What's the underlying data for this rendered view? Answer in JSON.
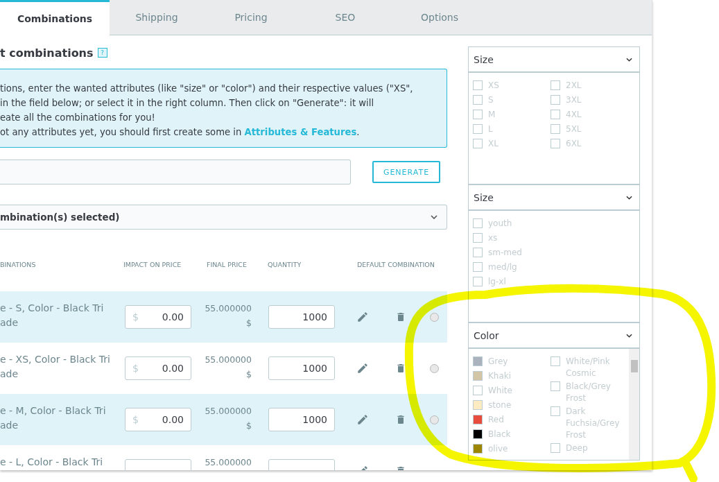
{
  "tabs": [
    {
      "label": "Combinations",
      "selected": true
    },
    {
      "label": "Shipping",
      "selected": false
    },
    {
      "label": "Pricing",
      "selected": false
    },
    {
      "label": "SEO",
      "selected": false
    },
    {
      "label": "Options",
      "selected": false
    }
  ],
  "heading": {
    "title": "t combinations",
    "help": "?"
  },
  "info": {
    "lines": [
      "tions, enter the wanted attributes (like \"size\" or \"color\") and their respective values (\"XS\",",
      "in the field below; or select it in the right column. Then click on \"Generate\": it will",
      "eate all the combinations for you!",
      "ot any attributes yet, you should first create some in "
    ],
    "link": "Attributes & Features",
    "after": "."
  },
  "generate_button": "GENERATE",
  "bulk_select": {
    "label": "mbination(s) selected)"
  },
  "table": {
    "columns": [
      "BINATIONS",
      "IMPACT ON PRICE",
      "FINAL PRICE",
      "QUANTITY",
      "DEFAULT COMBINATION"
    ],
    "rows": [
      {
        "combination": [
          "e - S, Color - Black Tri",
          "ade"
        ],
        "currency": "$",
        "impact": "0.00",
        "final_price": "55.000000",
        "final_currency": "$",
        "quantity": "1000",
        "selected": false
      },
      {
        "combination": [
          "e - XS, Color - Black Tri",
          "ade"
        ],
        "currency": "$",
        "impact": "0.00",
        "final_price": "55.000000",
        "final_currency": "$",
        "quantity": "1000",
        "selected": false
      },
      {
        "combination": [
          "e - M, Color - Black Tri",
          "ade"
        ],
        "currency": "$",
        "impact": "0.00",
        "final_price": "55.000000",
        "final_currency": "$",
        "quantity": "1000",
        "selected": false
      },
      {
        "combination": [
          "e - L, Color - Black Tri"
        ],
        "final_price": "55.000000"
      }
    ]
  },
  "attribute_groups": [
    {
      "title": "Size",
      "columns": [
        [
          {
            "kind": "checkbox",
            "label": "XS",
            "checked": false
          },
          {
            "kind": "checkbox",
            "label": "S",
            "checked": false
          },
          {
            "kind": "checkbox",
            "label": "M",
            "checked": false
          },
          {
            "kind": "checkbox",
            "label": "L",
            "checked": false
          },
          {
            "kind": "checkbox",
            "label": "XL",
            "checked": false
          }
        ],
        [
          {
            "kind": "checkbox",
            "label": "2XL",
            "checked": false
          },
          {
            "kind": "checkbox",
            "label": "3XL",
            "checked": false
          },
          {
            "kind": "checkbox",
            "label": "4XL",
            "checked": false
          },
          {
            "kind": "checkbox",
            "label": "5XL",
            "checked": false
          },
          {
            "kind": "checkbox",
            "label": "6XL",
            "checked": false
          }
        ]
      ]
    },
    {
      "title": "Size",
      "columns": [
        [
          {
            "kind": "checkbox",
            "label": "youth",
            "checked": false
          },
          {
            "kind": "checkbox",
            "label": "xs",
            "checked": false
          },
          {
            "kind": "checkbox",
            "label": "sm-med",
            "checked": false
          },
          {
            "kind": "checkbox",
            "label": "med/lg",
            "checked": false
          },
          {
            "kind": "checkbox",
            "label": "lg-xl",
            "checked": false
          }
        ]
      ]
    },
    {
      "title": "Color",
      "scroll": true,
      "columns": [
        [
          {
            "kind": "swatch",
            "label": "Grey",
            "color": "#aab2bd"
          },
          {
            "kind": "swatch",
            "label": "Khaki",
            "color": "#d2c6a6"
          },
          {
            "kind": "swatch",
            "label": "White",
            "color": "#ffffff"
          },
          {
            "kind": "swatch",
            "label": "stone",
            "color": "#ffebc2"
          },
          {
            "kind": "swatch",
            "label": "Red",
            "color": "#e84c3d"
          },
          {
            "kind": "swatch",
            "label": "Black",
            "color": "#000000"
          },
          {
            "kind": "swatch",
            "label": "olive",
            "color": "#9c8600"
          }
        ],
        [
          {
            "kind": "checkbox",
            "label": "White/Pink Cosmic",
            "checked": false
          },
          {
            "kind": "checkbox",
            "label": "Black/Grey Frost",
            "checked": false
          },
          {
            "kind": "checkbox",
            "label": "Dark Fuchsia/Grey Frost",
            "checked": false
          },
          {
            "kind": "checkbox",
            "label": "Deep",
            "checked": false
          }
        ]
      ]
    }
  ]
}
